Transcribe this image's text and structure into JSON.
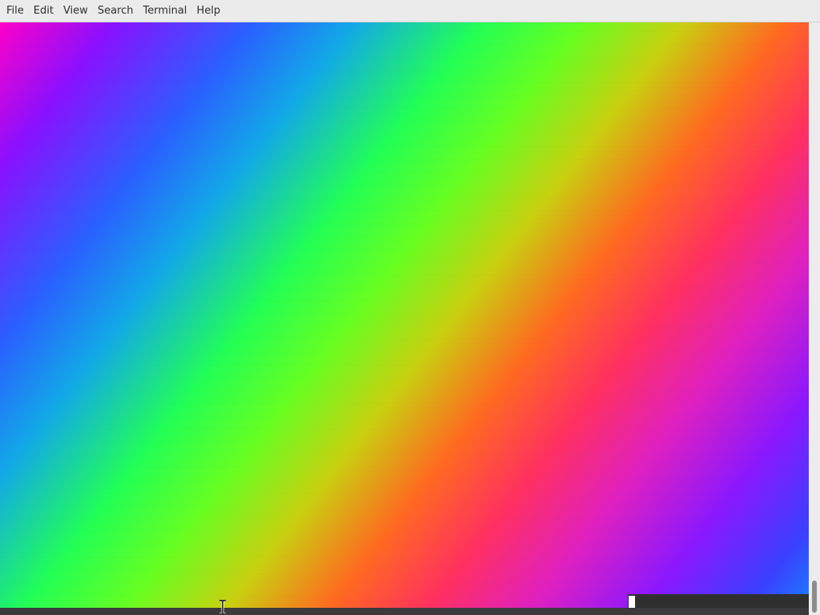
{
  "menubar": {
    "items": [
      {
        "label": "File"
      },
      {
        "label": "Edit"
      },
      {
        "label": "View"
      },
      {
        "label": "Search"
      },
      {
        "label": "Terminal"
      },
      {
        "label": "Help"
      }
    ]
  },
  "terminal": {
    "content": "color-gradient-output",
    "cursor": "block-cursor"
  },
  "pointer": {
    "icon": "text-ibeam-icon"
  },
  "colors": {
    "menubar_bg": "#ebebeb",
    "terminal_bg": "#2f2f2f",
    "gradient_stops": [
      "#ff00c8",
      "#8a10ff",
      "#2a60ff",
      "#12a8e8",
      "#22ff55",
      "#66ff22",
      "#c8d010",
      "#ff6a20",
      "#ff3060",
      "#e020c0",
      "#8a18ff",
      "#3a40ff",
      "#1a80ff"
    ]
  }
}
